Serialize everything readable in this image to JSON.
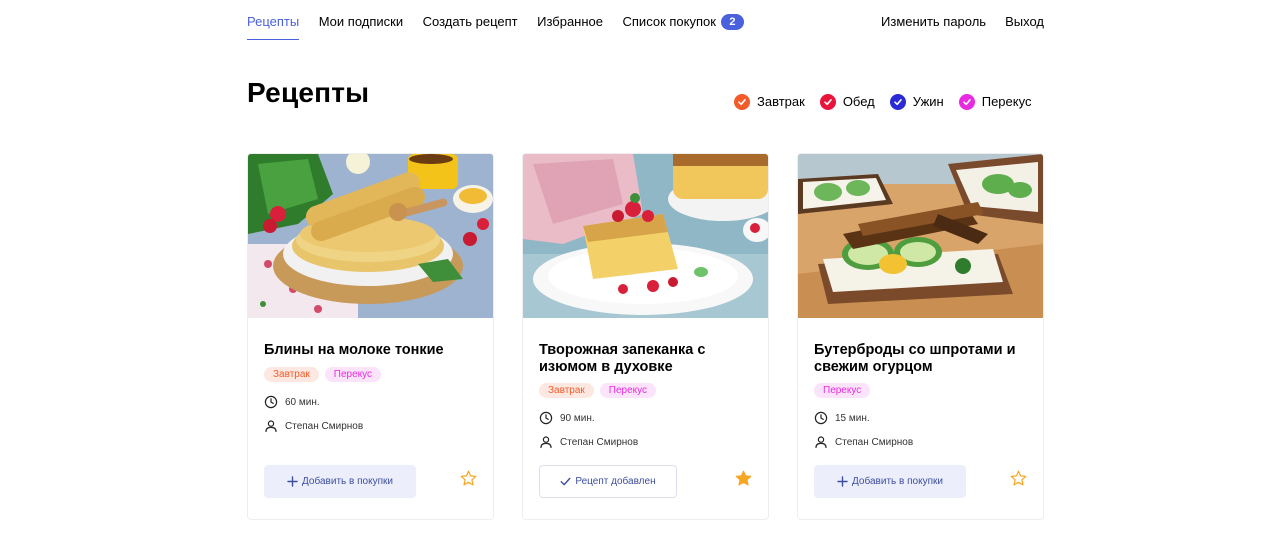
{
  "nav": {
    "items": [
      {
        "label": "Рецепты",
        "active": true
      },
      {
        "label": "Мои подписки"
      },
      {
        "label": "Создать рецепт"
      },
      {
        "label": "Избранное"
      },
      {
        "label": "Список покупок",
        "badge": "2"
      }
    ],
    "right": [
      {
        "label": "Изменить пароль"
      },
      {
        "label": "Выход"
      }
    ]
  },
  "page": {
    "title": "Рецепты"
  },
  "filters": [
    {
      "label": "Завтрак",
      "color": "#f35b2a"
    },
    {
      "label": "Обед",
      "color": "#e8143c"
    },
    {
      "label": "Ужин",
      "color": "#2a2ad6"
    },
    {
      "label": "Перекус",
      "color": "#e82be0"
    }
  ],
  "tag_styles": {
    "Завтрак": {
      "bg": "#fde8e1",
      "color": "#f35b2a"
    },
    "Перекус": {
      "bg": "#fbe3fa",
      "color": "#e82be0"
    }
  },
  "cards": [
    {
      "title": "Блины на молоке тонкие",
      "tags": [
        "Завтрак",
        "Перекус"
      ],
      "time": "60 мин.",
      "author": "Степан Смирнов",
      "button": {
        "label": "Добавить в покупки",
        "state": "add"
      },
      "favorite": false
    },
    {
      "title": "Творожная запеканка с изюмом в духовке",
      "tags": [
        "Завтрак",
        "Перекус"
      ],
      "time": "90 мин.",
      "author": "Степан Смирнов",
      "button": {
        "label": "Рецепт добавлен",
        "state": "added"
      },
      "favorite": true
    },
    {
      "title": "Бутерброды со шпротами и свежим огурцом",
      "tags": [
        "Перекус"
      ],
      "time": "15 мин.",
      "author": "Степан Смирнов",
      "button": {
        "label": "Добавить в покупки",
        "state": "add"
      },
      "favorite": false
    }
  ],
  "colors": {
    "accent": "#4a61dd",
    "star": "#f5a623"
  }
}
